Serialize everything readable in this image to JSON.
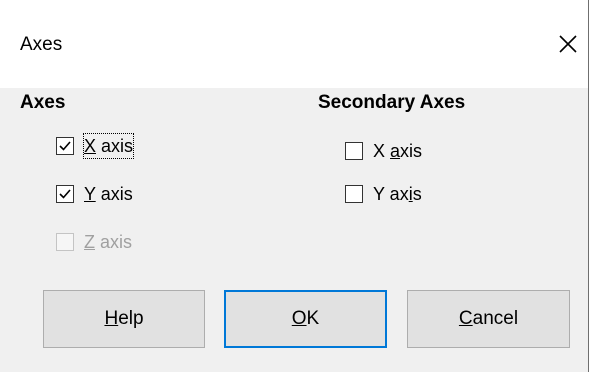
{
  "dialog": {
    "title": "Axes",
    "close_icon": "close-icon"
  },
  "axes": {
    "heading": "Axes",
    "x": {
      "pre": "",
      "key": "X",
      "post": " axis",
      "checked": true,
      "enabled": true
    },
    "y": {
      "pre": "",
      "key": "Y",
      "post": " axis",
      "checked": true,
      "enabled": true
    },
    "z": {
      "pre": "",
      "key": "Z",
      "post": " axis",
      "checked": false,
      "enabled": false
    }
  },
  "secondary_axes": {
    "heading": "Secondary Axes",
    "x": {
      "pre": "X ",
      "key": "a",
      "post": "xis",
      "checked": false,
      "enabled": true
    },
    "y": {
      "pre": "Y ax",
      "key": "i",
      "post": "s",
      "checked": false,
      "enabled": true
    }
  },
  "buttons": {
    "help": {
      "pre": "",
      "key": "H",
      "post": "elp"
    },
    "ok": {
      "pre": "",
      "key": "O",
      "post": "K"
    },
    "cancel": {
      "pre": "",
      "key": "C",
      "post": "ancel"
    }
  },
  "colors": {
    "accent": "#0078d7",
    "button_face": "#e1e1e1",
    "dialog_bg": "#f0f0f0"
  }
}
